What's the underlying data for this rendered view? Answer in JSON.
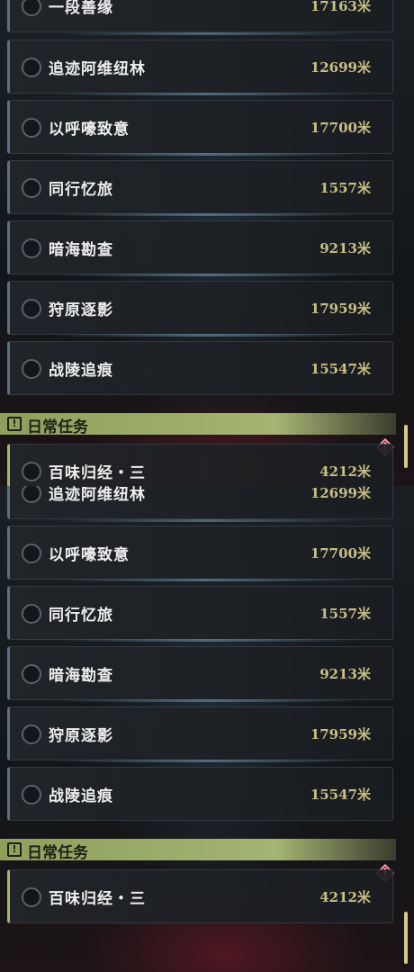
{
  "top_view": {
    "quests": [
      {
        "name": "一段善缘",
        "distance": "17163米"
      },
      {
        "name": "追迹阿维纽林",
        "distance": "12699米"
      },
      {
        "name": "以呼嚎致意",
        "distance": "17700米"
      },
      {
        "name": "同行忆旅",
        "distance": "1557米"
      },
      {
        "name": "暗海勘查",
        "distance": "9213米"
      },
      {
        "name": "狩原逐影",
        "distance": "17959米"
      },
      {
        "name": "战陵追痕",
        "distance": "15547米"
      }
    ],
    "daily_header": "日常任务",
    "daily_quests": [
      {
        "name": "百味归经・三",
        "distance": "4212米"
      }
    ]
  },
  "bottom_view": {
    "quests": [
      {
        "name": "追迹阿维纽林",
        "distance": "12699米"
      },
      {
        "name": "以呼嚎致意",
        "distance": "17700米"
      },
      {
        "name": "同行忆旅",
        "distance": "1557米"
      },
      {
        "name": "暗海勘查",
        "distance": "9213米"
      },
      {
        "name": "狩原逐影",
        "distance": "17959米"
      },
      {
        "name": "战陵追痕",
        "distance": "15547米"
      }
    ],
    "daily_header": "日常任务",
    "daily_quests": [
      {
        "name": "百味归经・三",
        "distance": "4212米"
      }
    ]
  },
  "icons": {
    "section_header_icon": "exclamation-box-icon",
    "alert_icon": "red-diamond-alert-icon",
    "quest_marker": "empty-circle-icon"
  },
  "colors": {
    "accent_green": "#a4b472",
    "distance_gold": "#c9bf86",
    "alert_red": "#c0304a",
    "scrollbar": "#d8c98c"
  }
}
